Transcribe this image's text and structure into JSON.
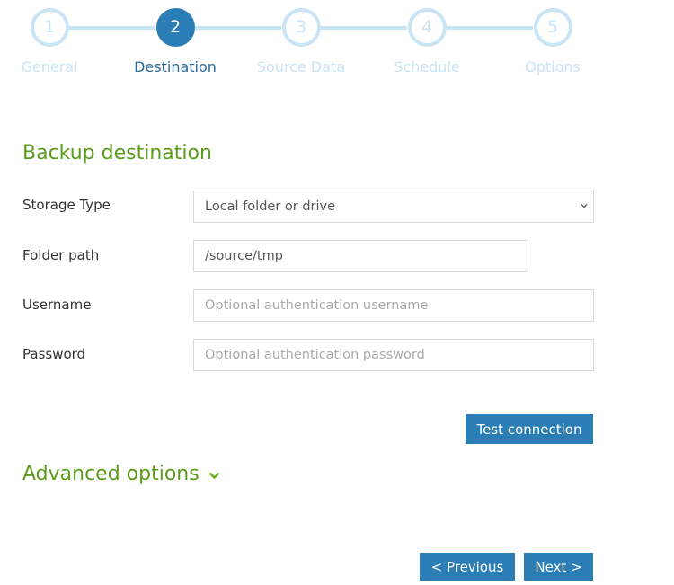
{
  "wizard": {
    "current_step": 2,
    "steps": [
      {
        "number": "1",
        "label": "General"
      },
      {
        "number": "2",
        "label": "Destination"
      },
      {
        "number": "3",
        "label": "Source Data"
      },
      {
        "number": "4",
        "label": "Schedule"
      },
      {
        "number": "5",
        "label": "Options"
      }
    ]
  },
  "section": {
    "title": "Backup destination"
  },
  "form": {
    "storage_type": {
      "label": "Storage Type",
      "value": "Local folder or drive"
    },
    "folder_path": {
      "label": "Folder path",
      "value": "/source/tmp"
    },
    "username": {
      "label": "Username",
      "value": "",
      "placeholder": "Optional authentication username"
    },
    "password": {
      "label": "Password",
      "value": "",
      "placeholder": "Optional authentication password"
    }
  },
  "buttons": {
    "test_connection": "Test connection",
    "previous": "< Previous",
    "next": "Next >"
  },
  "advanced": {
    "label": "Advanced options",
    "icon": "chevron-down-icon"
  },
  "colors": {
    "primary": "#2a7db5",
    "inactive_step": "#c9e4f5",
    "section_heading": "#5c9b1c"
  }
}
